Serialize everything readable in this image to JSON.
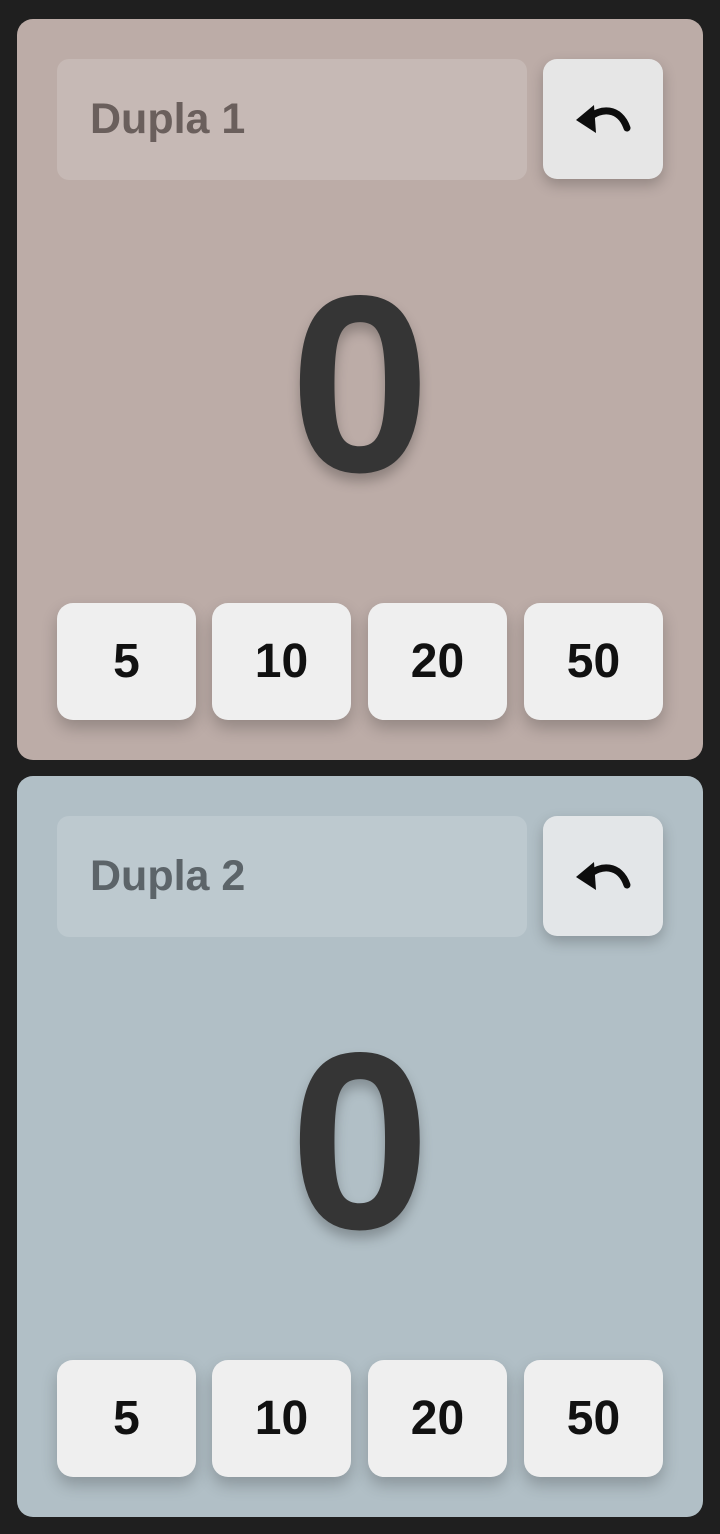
{
  "teams": [
    {
      "name_value": "",
      "name_placeholder": "Dupla 1",
      "score": "0",
      "undo_icon": "undo-icon",
      "point_buttons": [
        "5",
        "10",
        "20",
        "50"
      ],
      "color": "#bcaca7"
    },
    {
      "name_value": "",
      "name_placeholder": "Dupla 2",
      "score": "0",
      "undo_icon": "undo-icon",
      "point_buttons": [
        "5",
        "10",
        "20",
        "50"
      ],
      "color": "#b1bfc6"
    }
  ]
}
